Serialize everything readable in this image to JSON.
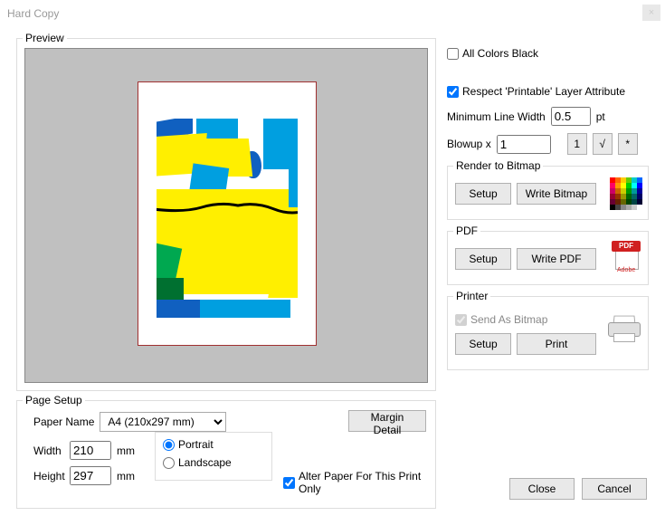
{
  "window": {
    "title": "Hard Copy"
  },
  "preview": {
    "legend": "Preview"
  },
  "page_setup": {
    "legend": "Page Setup",
    "paper_name_label": "Paper Name",
    "paper_name_value": "A4    (210x297 mm)",
    "width_label": "Width",
    "width_value": "210",
    "height_label": "Height",
    "height_value": "297",
    "unit": "mm",
    "portrait_label": "Portrait",
    "landscape_label": "Landscape",
    "alter_paper_label": "Alter Paper For This Print Only",
    "alter_paper_checked": true,
    "portrait_selected": true,
    "margin_detail_btn": "Margin Detail"
  },
  "options": {
    "all_colors_black_label": "All Colors Black",
    "all_colors_black_checked": false,
    "respect_printable_label": "Respect 'Printable' Layer Attribute",
    "respect_printable_checked": true,
    "min_line_width_label": "Minimum Line Width",
    "min_line_width_value": "0.5",
    "min_line_width_unit": "pt",
    "blowup_label": "Blowup  x",
    "blowup_value": "1",
    "blowup_btn_1": "1",
    "blowup_btn_sqrt": "√",
    "blowup_btn_star": "*"
  },
  "render_bitmap": {
    "legend": "Render to Bitmap",
    "setup_btn": "Setup",
    "write_btn": "Write Bitmap"
  },
  "pdf": {
    "legend": "PDF",
    "setup_btn": "Setup",
    "write_btn": "Write PDF",
    "badge": "PDF",
    "sub": "Adobe"
  },
  "printer": {
    "legend": "Printer",
    "send_as_bitmap_label": "Send As Bitmap",
    "send_as_bitmap_checked": true,
    "setup_btn": "Setup",
    "print_btn": "Print"
  },
  "buttons": {
    "close": "Close",
    "cancel": "Cancel"
  }
}
